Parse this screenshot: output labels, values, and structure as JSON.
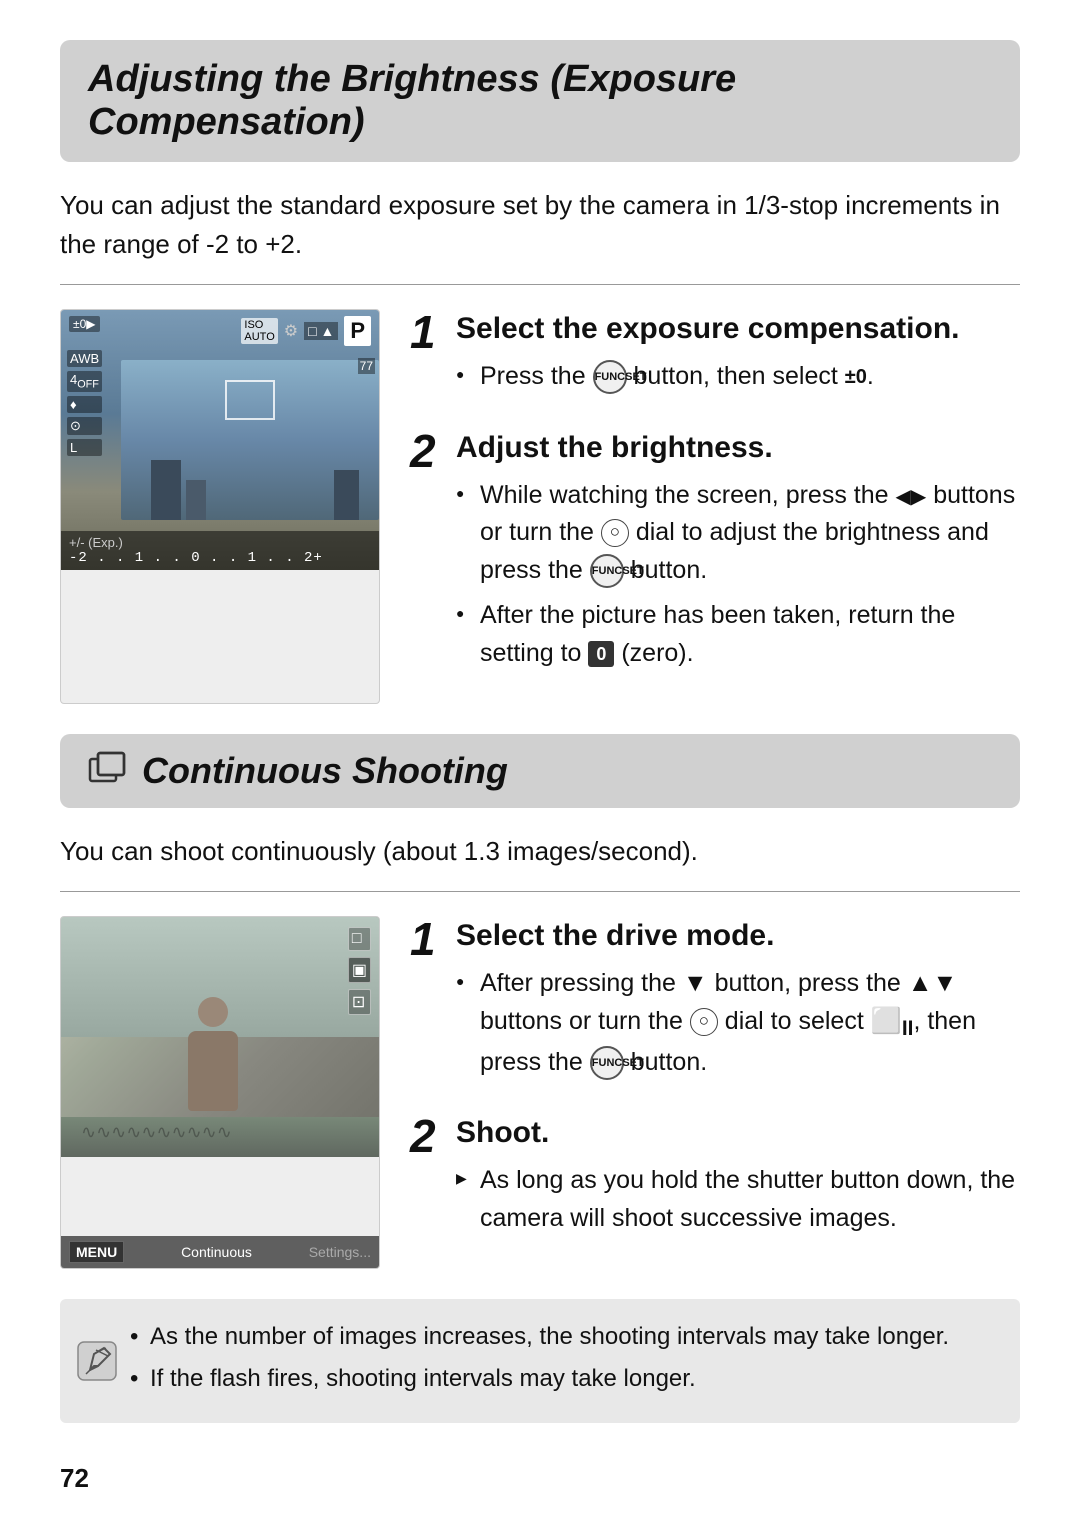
{
  "page": {
    "number": "72"
  },
  "section1": {
    "title": "Adjusting the Brightness (Exposure Compensation)",
    "intro": "You can adjust the standard exposure set by the camera in 1/3-stop increments in the range of -2 to +2.",
    "steps": [
      {
        "number": "1",
        "title": "Select the exposure compensation.",
        "bullets": [
          {
            "type": "bullet",
            "text_prefix": "Press the ",
            "icon": "func-btn",
            "text_suffix": " button, then select ±0."
          }
        ]
      },
      {
        "number": "2",
        "title": "Adjust the brightness.",
        "bullets": [
          {
            "type": "bullet",
            "text": "While watching the screen, press the ◀▶ buttons or turn the dial to adjust the brightness and press the button."
          },
          {
            "type": "bullet",
            "text": "After the picture has been taken, return the setting to  (zero)."
          }
        ]
      }
    ]
  },
  "section2": {
    "title": "Continuous Shooting",
    "intro": "You can shoot continuously (about 1.3 images/second).",
    "steps": [
      {
        "number": "1",
        "title": "Select the drive mode.",
        "bullets": [
          {
            "type": "bullet",
            "text": "After pressing the ▼ button, press the ▲▼ buttons or turn the dial to select , then press the button."
          }
        ]
      },
      {
        "number": "2",
        "title": "Shoot.",
        "bullets": [
          {
            "type": "arrow",
            "text": "As long as you hold the shutter button down, the camera will shoot successive images."
          }
        ]
      }
    ]
  },
  "note": {
    "bullets": [
      "As the number of images increases, the shooting intervals may take longer.",
      "If the flash fires, shooting intervals may take longer."
    ]
  },
  "lcd": {
    "mode": "P",
    "exposure_label": "+/- (Exp.)",
    "scale": "-2 . . 1 . . 0 . . 1 . . 2+"
  },
  "photo": {
    "label": "Continuous",
    "menu_label": "MENU",
    "settings_label": "Settings..."
  }
}
